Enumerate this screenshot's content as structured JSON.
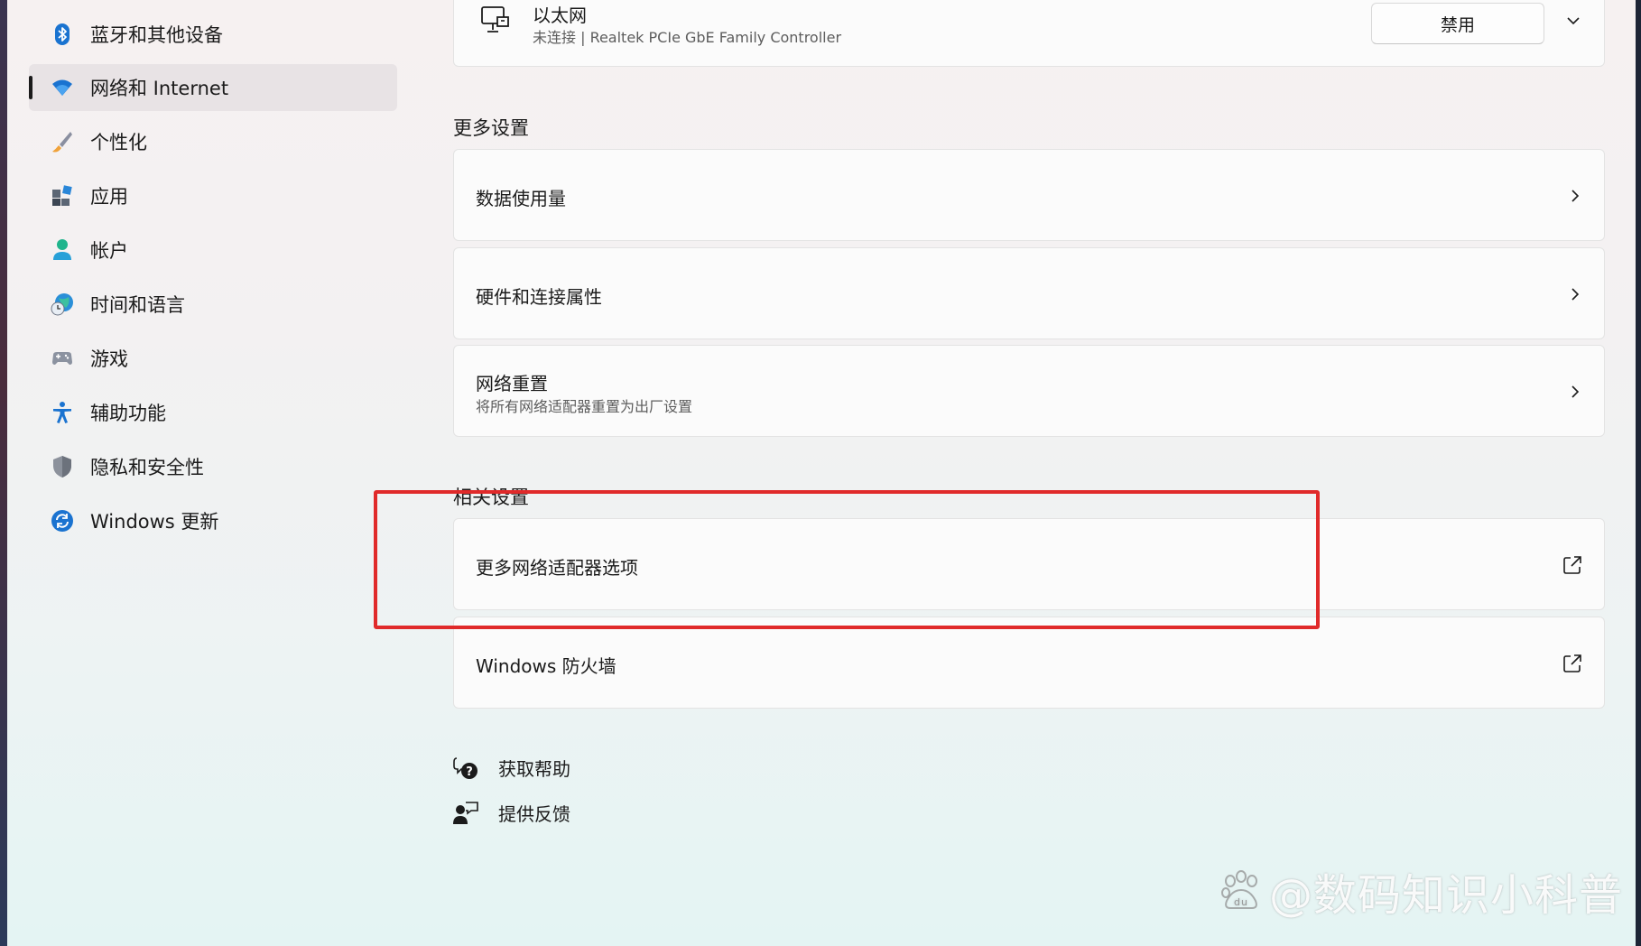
{
  "sidebar": {
    "items": [
      {
        "label": "蓝牙和其他设备",
        "icon": "bluetooth-icon"
      },
      {
        "label": "网络和 Internet",
        "icon": "wifi-icon",
        "active": true
      },
      {
        "label": "个性化",
        "icon": "brush-icon"
      },
      {
        "label": "应用",
        "icon": "apps-icon"
      },
      {
        "label": "帐户",
        "icon": "account-icon"
      },
      {
        "label": "时间和语言",
        "icon": "globe-clock-icon"
      },
      {
        "label": "游戏",
        "icon": "gamepad-icon"
      },
      {
        "label": "辅助功能",
        "icon": "accessibility-icon"
      },
      {
        "label": "隐私和安全性",
        "icon": "shield-icon"
      },
      {
        "label": "Windows 更新",
        "icon": "update-icon"
      }
    ]
  },
  "ethernet": {
    "title": "以太网",
    "subtitle": "未连接 | Realtek PCIe GbE Family Controller",
    "button": "禁用"
  },
  "more_settings": {
    "heading": "更多设置",
    "items": [
      {
        "title": "数据使用量"
      },
      {
        "title": "硬件和连接属性"
      },
      {
        "title": "网络重置",
        "subtitle": "将所有网络适配器重置为出厂设置"
      }
    ]
  },
  "related_settings": {
    "heading": "相关设置",
    "items": [
      {
        "title": "更多网络适配器选项"
      },
      {
        "title": "Windows 防火墙"
      }
    ]
  },
  "links": {
    "help": "获取帮助",
    "feedback": "提供反馈"
  },
  "watermark": "@数码知识小科普",
  "colors": {
    "accent": "#0067c0",
    "highlight": "#e02a2a"
  }
}
